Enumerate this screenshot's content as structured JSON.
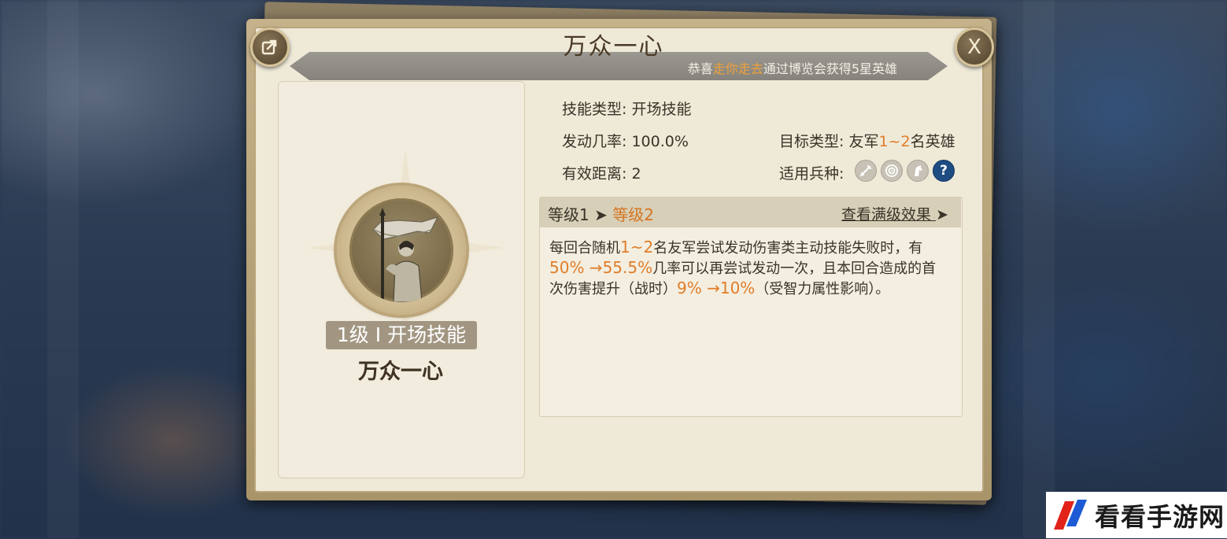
{
  "dialog": {
    "title": "万众一心",
    "notice": {
      "prefix": "恭喜",
      "player": "走你走去",
      "suffix": "通过博览会获得5星英雄"
    }
  },
  "icons": {
    "share": "share-icon",
    "close": "close-icon",
    "close_glyph": "X"
  },
  "skill": {
    "badge": "1级 I 开场技能",
    "name": "万众一心"
  },
  "attributes": {
    "type_label": "技能类型: 开场技能",
    "chance_label": "发动几率: 100.0%",
    "range_label": "有效距离: 2",
    "target_prefix": "目标类型: 友军",
    "target_range": "1~2",
    "target_suffix": "名英雄",
    "troops_label": "适用兵种:",
    "troops": [
      "sword-icon",
      "bow-target-icon",
      "horse-icon",
      "help-icon"
    ],
    "help_glyph": "?"
  },
  "levels": {
    "level1": "等级1",
    "arrow": "➤",
    "level2": "等级2",
    "full_effect": "查看满级效果",
    "full_arrow": "➤"
  },
  "description": {
    "p1": "每回合随机",
    "v1": "1~2",
    "p2": "名友军尝试发动伤害类主动技能失败时，有",
    "v2": "50% →55.5%",
    "p3": "几率可以再尝试发动一次，且本回合造成的首次伤害提升（战时）",
    "v3": "9% →10%",
    "p4": "（受智力属性影响）。"
  },
  "watermark": {
    "text": "看看手游网"
  },
  "colors": {
    "highlight": "#e07d2a",
    "notice_highlight": "#f0a03c",
    "help": "#1f4c82"
  }
}
